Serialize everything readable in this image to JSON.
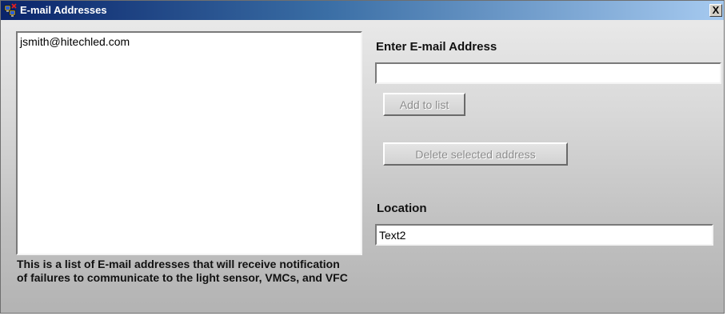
{
  "window": {
    "title": "E-mail Addresses",
    "close_label": "X",
    "app_icon": "network-computers-icon"
  },
  "email_list": {
    "items": [
      "jsmith@hitechled.com"
    ],
    "description": "This is a list of E-mail addresses that will receive notification of failures to communicate to the light sensor, VMCs, and VFC"
  },
  "form": {
    "email_label": "Enter E-mail Address",
    "email_value": "",
    "add_button": "Add to list",
    "delete_button": "Delete selected address",
    "location_label": "Location",
    "location_value": "Text2"
  }
}
